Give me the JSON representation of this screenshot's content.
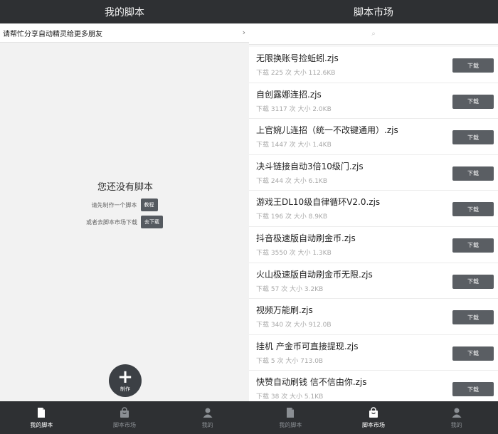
{
  "left": {
    "title": "我的脚本",
    "share_text": "请帮忙分享自动精灵给更多朋友",
    "share_chevron": "›",
    "empty_title": "您还没有脚本",
    "empty_line1": "请先制作一个脚本",
    "tutorial_btn": "教程",
    "empty_line2": "或者去脚本市场下载",
    "goto_btn": "去下载",
    "fab_plus": "+",
    "fab_label": "制作"
  },
  "right": {
    "title": "脚本市场",
    "search_icon": "⌕",
    "download_label": "下载",
    "items": [
      {
        "name": "无限换账号捡蚯蚓.zjs",
        "meta": "下载 225 次 大小 112.6KB"
      },
      {
        "name": "自创露娜连招.zjs",
        "meta": "下载 3117 次 大小 2.0KB"
      },
      {
        "name": "上官婉儿连招（统一不改键通用）.zjs",
        "meta": "下载 1447 次 大小 1.4KB"
      },
      {
        "name": "决斗链接自动3倍10级门.zjs",
        "meta": "下载 244 次 大小 6.1KB"
      },
      {
        "name": "游戏王DL10级自律循环V2.0.zjs",
        "meta": "下载 196 次 大小 8.9KB"
      },
      {
        "name": "抖音极速版自动刷金币.zjs",
        "meta": "下载 3550 次 大小 1.3KB"
      },
      {
        "name": "火山极速版自动刷金币无限.zjs",
        "meta": "下载 57 次 大小 3.2KB"
      },
      {
        "name": "视频万能刷.zjs",
        "meta": "下载 340 次 大小 912.0B"
      },
      {
        "name": "挂机 产金币可直接提现.zjs",
        "meta": "下载 5 次 大小 713.0B"
      },
      {
        "name": "快赞自动刷钱 信不信由你.zjs",
        "meta": "下载 38 次 大小 5.1KB"
      }
    ]
  },
  "tabs": [
    {
      "label": "我的脚本",
      "icon": "document-icon"
    },
    {
      "label": "脚本市场",
      "icon": "shopping-bag-icon"
    },
    {
      "label": "我的",
      "icon": "person-icon"
    }
  ]
}
